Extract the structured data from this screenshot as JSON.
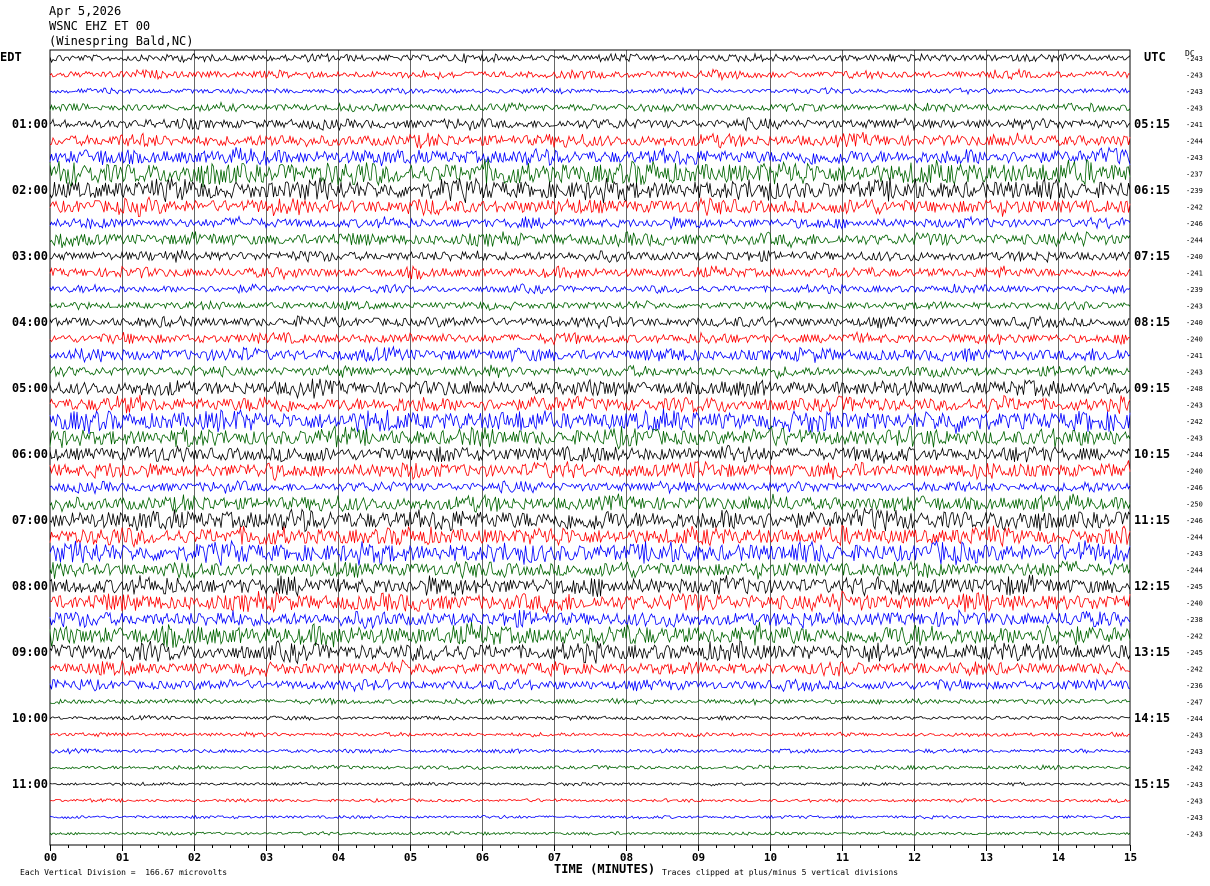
{
  "header": {
    "date": "Apr 5,2026",
    "station": "WSNC EHZ ET 00",
    "location": "(Winespring Bald,NC)"
  },
  "left_tz": "EDT",
  "right_tz": "UTC",
  "dc_label": "DC",
  "footer": {
    "scale": "Each Vertical Division =  166.67 microvolts",
    "xlabel": "TIME (MINUTES)",
    "clip": "Traces clipped at plus/minus 5 vertical divisions"
  },
  "chart_data": {
    "type": "line",
    "title": "WSNC EHZ ET 00 (Winespring Bald,NC) Apr 5,2026",
    "xlabel": "TIME (MINUTES)",
    "xlim": [
      0,
      15
    ],
    "x_ticks": [
      "00",
      "01",
      "02",
      "03",
      "04",
      "05",
      "06",
      "07",
      "08",
      "09",
      "10",
      "11",
      "12",
      "13",
      "14",
      "15"
    ],
    "trace_colors": [
      "#000000",
      "#ff0000",
      "#0000ff",
      "#006400"
    ],
    "left_hour_labels": [
      "01:00",
      "02:00",
      "03:00",
      "04:00",
      "05:00",
      "06:00",
      "07:00",
      "08:00",
      "09:00",
      "10:00",
      "11:00"
    ],
    "right_hour_labels": [
      "05:15",
      "06:15",
      "07:15",
      "08:15",
      "09:15",
      "10:15",
      "11:15",
      "12:15",
      "13:15",
      "14:15",
      "15:15"
    ],
    "dc_offsets": [
      -243,
      -243,
      -243,
      -243,
      -241,
      -244,
      -243,
      -237,
      -239,
      -242,
      -246,
      -244,
      -240,
      -241,
      -239,
      -243,
      -240,
      -240,
      -241,
      -243,
      -248,
      -243,
      -242,
      -243,
      -244,
      -240,
      -246,
      -250,
      -246,
      -244,
      -243,
      -244,
      -245,
      -240,
      -238,
      -242,
      -245,
      -242,
      -236,
      -247,
      -244,
      -243,
      -243,
      -242,
      -243,
      -243,
      -243,
      -243
    ],
    "amplitude_levels": [
      3,
      3,
      2,
      3,
      4,
      5,
      6,
      9,
      8,
      6,
      4,
      5,
      4,
      4,
      3,
      3,
      4,
      4,
      5,
      4,
      6,
      6,
      8,
      7,
      6,
      6,
      4,
      6,
      8,
      7,
      8,
      6,
      7,
      7,
      6,
      8,
      7,
      5,
      4,
      2,
      1.5,
      1.5,
      1.5,
      1.5,
      1.2,
      1.2,
      1.2,
      1.2
    ]
  }
}
